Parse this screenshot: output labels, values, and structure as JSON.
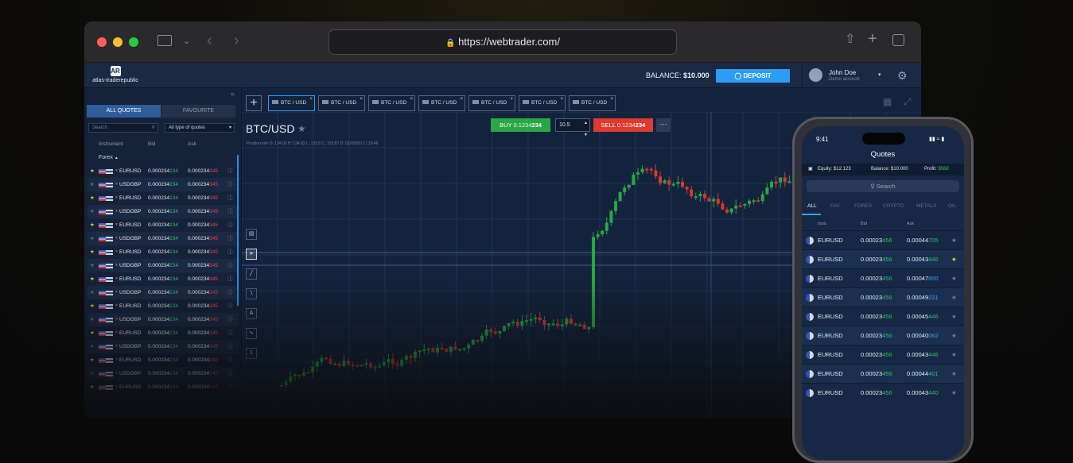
{
  "browser": {
    "url": "https://webtrader.com/"
  },
  "header": {
    "logo_text": "atlas-traderepublic",
    "balance_label": "BALANCE:",
    "balance_value": "$10.000",
    "deposit_label": "DEPOSIT",
    "user_name": "John Doe",
    "user_sub": "Demo account"
  },
  "sidebar": {
    "tabs": [
      "ALL QUOTES",
      "FAVOURITE"
    ],
    "search_placeholder": "Search",
    "filter_value": "All type of quotes",
    "columns": [
      "Instrument",
      "Bid",
      "Ask"
    ],
    "group": "Forex",
    "rows": [
      {
        "fav": true,
        "symbol": "EURUSD",
        "bid_a": "0.000234",
        "bid_b": "234",
        "ask_a": "0.000234",
        "ask_b": "345"
      },
      {
        "fav": false,
        "symbol": "USDGBP",
        "bid_a": "0.000234",
        "bid_b": "234",
        "ask_a": "0.000234",
        "ask_b": "345"
      },
      {
        "fav": true,
        "symbol": "EURUSD",
        "bid_a": "0.000234",
        "bid_b": "234",
        "ask_a": "0.000234",
        "ask_b": "345"
      },
      {
        "fav": false,
        "symbol": "USDGBP",
        "bid_a": "0.000234",
        "bid_b": "234",
        "ask_a": "0.000234",
        "ask_b": "345"
      },
      {
        "fav": true,
        "symbol": "EURUSD",
        "bid_a": "0.000234",
        "bid_b": "234",
        "ask_a": "0.000234",
        "ask_b": "345"
      },
      {
        "fav": false,
        "symbol": "USDGBP",
        "bid_a": "0.000234",
        "bid_b": "234",
        "ask_a": "0.000234",
        "ask_b": "345"
      },
      {
        "fav": true,
        "symbol": "EURUSD",
        "bid_a": "0.000234",
        "bid_b": "234",
        "ask_a": "0.000234",
        "ask_b": "345"
      },
      {
        "fav": false,
        "symbol": "USDGBP",
        "bid_a": "0.000234",
        "bid_b": "234",
        "ask_a": "0.000234",
        "ask_b": "345"
      },
      {
        "fav": true,
        "symbol": "EURUSD",
        "bid_a": "0.000234",
        "bid_b": "234",
        "ask_a": "0.000234",
        "ask_b": "345"
      },
      {
        "fav": false,
        "symbol": "USDGBP",
        "bid_a": "0.000234",
        "bid_b": "234",
        "ask_a": "0.000234",
        "ask_b": "345"
      },
      {
        "fav": true,
        "symbol": "EURUSD",
        "bid_a": "0.000234",
        "bid_b": "234",
        "ask_a": "0.000234",
        "ask_b": "345"
      },
      {
        "fav": false,
        "symbol": "USDGBP",
        "bid_a": "0.000234",
        "bid_b": "234",
        "ask_a": "0.000234",
        "ask_b": "345"
      },
      {
        "fav": true,
        "symbol": "EURUSD",
        "bid_a": "0.000234",
        "bid_b": "234",
        "ask_a": "0.000234",
        "ask_b": "345"
      },
      {
        "fav": false,
        "symbol": "USDGBP",
        "bid_a": "0.000234",
        "bid_b": "234",
        "ask_a": "0.000234",
        "ask_b": "345"
      },
      {
        "fav": true,
        "symbol": "EURUSD",
        "bid_a": "0.000234",
        "bid_b": "234",
        "ask_a": "0.000234",
        "ask_b": "345"
      },
      {
        "fav": false,
        "symbol": "USDGBP",
        "bid_a": "0.000234",
        "bid_b": "234",
        "ask_a": "0.000234",
        "ask_b": "345"
      },
      {
        "fav": true,
        "symbol": "EURUSD",
        "bid_a": "0.000234",
        "bid_b": "234",
        "ask_a": "0.000234",
        "ask_b": "345"
      }
    ]
  },
  "chart_tabs": [
    "BTC / USD",
    "BTC / USD",
    "BTC / USD",
    "BTC / USD",
    "BTC / USD",
    "BTC / USD",
    "BTC / USD"
  ],
  "chart": {
    "pair": "BTC/USD",
    "info": "Position info   O: 134.00   H: 134.82   L: 133.8   C: 133.87   D: 01/09/2017  |  18:46",
    "buy_label": "BUY",
    "buy_price_a": "0.1234",
    "buy_price_b": "234",
    "quantity": "10.5",
    "sell_label": "SELL",
    "sell_price_a": "0.1234",
    "sell_price_b": "234",
    "more": "···"
  },
  "tools": [
    "chart-type",
    "cursor",
    "line",
    "trend",
    "text",
    "indicator",
    "scale"
  ],
  "phone": {
    "time": "9:41",
    "title": "Quotes",
    "equity_label": "Equity:",
    "equity_value": "$12.123",
    "balance_label": "Balance:",
    "balance_value": "$10.000",
    "profit_label": "Profit:",
    "profit_value": "$568",
    "search_placeholder": "Search",
    "tabs": [
      "ALL",
      "FAV",
      "FOREX",
      "CRYPTO",
      "METALS",
      "OIL"
    ],
    "columns": [
      "Instr.",
      "Bid",
      "Ask"
    ],
    "rows": [
      {
        "symbol": "EURUSD",
        "bid_a": "0.00023",
        "bid_b": "456",
        "ask_a": "0.00044",
        "ask_b": "705",
        "ask_color": "#2fbf60",
        "fav": false
      },
      {
        "symbol": "EURUSD",
        "bid_a": "0.00023",
        "bid_b": "456",
        "ask_a": "0.00043",
        "ask_b": "446",
        "ask_color": "#2fbf60",
        "fav": true
      },
      {
        "symbol": "EURUSD",
        "bid_a": "0.00023",
        "bid_b": "456",
        "ask_a": "0.00047",
        "ask_b": "800",
        "ask_color": "#3aa0f0",
        "fav": false
      },
      {
        "symbol": "EURUSD",
        "bid_a": "0.00023",
        "bid_b": "456",
        "ask_a": "0.00049",
        "ask_b": "231",
        "ask_color": "#3aa0f0",
        "fav": false
      },
      {
        "symbol": "EURUSD",
        "bid_a": "0.00023",
        "bid_b": "456",
        "ask_a": "0.00045",
        "ask_b": "446",
        "ask_color": "#2fbf60",
        "fav": false
      },
      {
        "symbol": "EURUSD",
        "bid_a": "0.00023",
        "bid_b": "456",
        "ask_a": "0.00040",
        "ask_b": "062",
        "ask_color": "#3aa0f0",
        "fav": false
      },
      {
        "symbol": "EURUSD",
        "bid_a": "0.00023",
        "bid_b": "456",
        "ask_a": "0.00043",
        "ask_b": "446",
        "ask_color": "#2fbf60",
        "fav": false
      },
      {
        "symbol": "EURUSD",
        "bid_a": "0.00023",
        "bid_b": "456",
        "ask_a": "0.00044",
        "ask_b": "401",
        "ask_color": "#2fbf60",
        "fav": false
      },
      {
        "symbol": "EURUSD",
        "bid_a": "0.00023",
        "bid_b": "456",
        "ask_a": "0.00043",
        "ask_b": "440",
        "ask_color": "#2fbf60",
        "fav": false
      }
    ]
  },
  "colors": {
    "buy": "#28a745",
    "sell": "#dd3b30",
    "accent": "#2b9df4",
    "panel": "#152238"
  }
}
